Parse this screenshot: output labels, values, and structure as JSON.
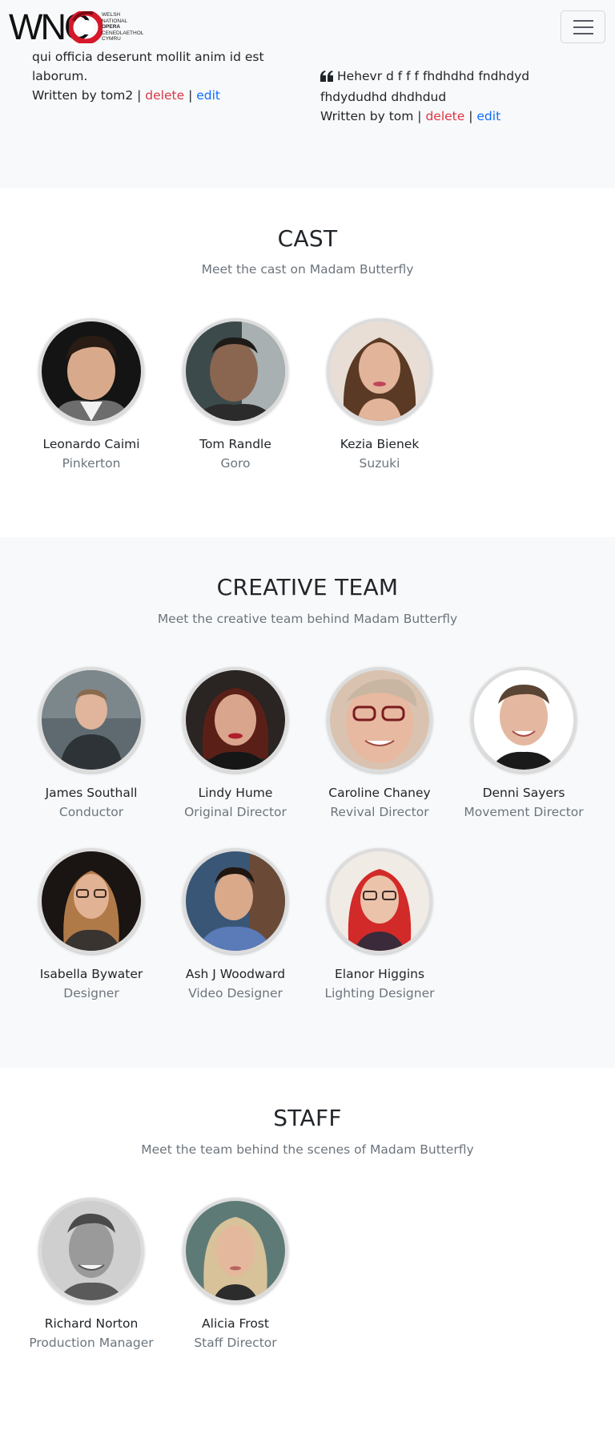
{
  "logo": {
    "word": "WNO",
    "lines": [
      "WELSH",
      "NATIONAL",
      "OPERA",
      "CENEDLAETHOL",
      "CYMRU"
    ]
  },
  "navbar": {
    "toggle_icon": "hamburger-icon"
  },
  "reviews": [
    {
      "text": "qui officia deserunt mollit anim id est laborum.",
      "written_by": "Written by tom2 |",
      "delete_label": "delete",
      "separator": "|",
      "edit_label": "edit"
    },
    {
      "quote_icon": "quote-left-icon",
      "text": "Hehevr d f f f fhdhdhd fndhdyd fhdydudhd dhdhdud",
      "written_by": "Written by tom |",
      "delete_label": "delete",
      "separator": "|",
      "edit_label": "edit"
    }
  ],
  "cast": {
    "title": "CAST",
    "subtitle": "Meet the cast on Madam Butterfly",
    "members": [
      {
        "name": "Leonardo Caimi",
        "role": "Pinkerton"
      },
      {
        "name": "Tom Randle",
        "role": "Goro"
      },
      {
        "name": "Kezia Bienek",
        "role": "Suzuki"
      }
    ]
  },
  "creative": {
    "title": "CREATIVE TEAM",
    "subtitle": "Meet the creative team behind Madam Butterfly",
    "members": [
      {
        "name": "James Southall",
        "role": "Conductor"
      },
      {
        "name": "Lindy Hume",
        "role": "Original Director"
      },
      {
        "name": "Caroline Chaney",
        "role": "Revival Director"
      },
      {
        "name": "Denni Sayers",
        "role": "Movement Director"
      },
      {
        "name": "Isabella Bywater",
        "role": "Designer"
      },
      {
        "name": "Ash J Woodward",
        "role": "Video Designer"
      },
      {
        "name": "Elanor Higgins",
        "role": "Lighting Designer"
      }
    ]
  },
  "staff": {
    "title": "STAFF",
    "subtitle": "Meet the team behind the scenes of Madam Butterfly",
    "members": [
      {
        "name": "Richard Norton",
        "role": "Production Manager"
      },
      {
        "name": "Alicia Frost",
        "role": "Staff Director"
      }
    ]
  },
  "colors": {
    "brand_red": "#d7182a",
    "link_danger": "#dc3545",
    "link_primary": "#0d6efd",
    "muted": "#6c757d",
    "light_bg": "#f8f9fa"
  }
}
